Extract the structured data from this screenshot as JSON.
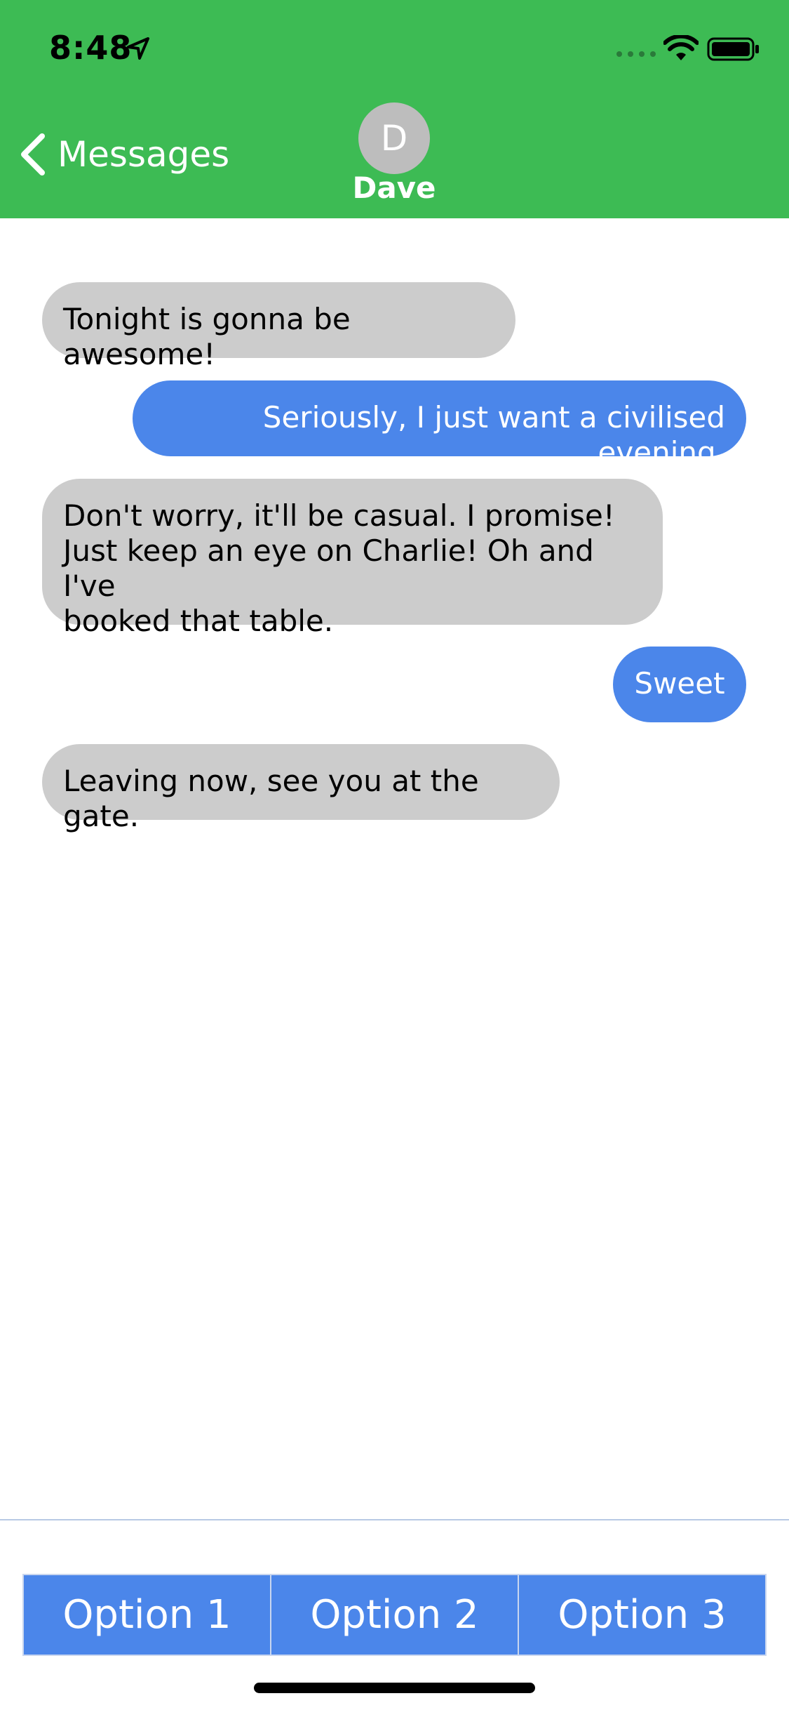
{
  "status_bar": {
    "time": "8:48",
    "icons": [
      "location-arrow-icon",
      "cellular-signal-icon",
      "wifi-icon",
      "battery-icon"
    ]
  },
  "nav": {
    "back_label": "Messages",
    "contact_initial": "D",
    "contact_name": "Dave"
  },
  "messages": [
    {
      "direction": "incoming",
      "text": "Tonight is gonna be awesome!"
    },
    {
      "direction": "outgoing",
      "text": "Seriously, I just want a civilised evening."
    },
    {
      "direction": "incoming",
      "text": "Don't worry, it'll be casual. I promise!\nJust keep an eye on Charlie! Oh and I've\nbooked that table."
    },
    {
      "direction": "outgoing",
      "text": "Sweet"
    },
    {
      "direction": "incoming",
      "text": "Leaving now, see you at the gate."
    }
  ],
  "options": [
    {
      "label": "Option 1"
    },
    {
      "label": "Option 2"
    },
    {
      "label": "Option 3"
    }
  ],
  "colors": {
    "header_green": "#3dbb54",
    "outgoing_blue": "#4b86ea",
    "incoming_gray": "#cccccc",
    "avatar_gray": "#bdbdbd"
  }
}
